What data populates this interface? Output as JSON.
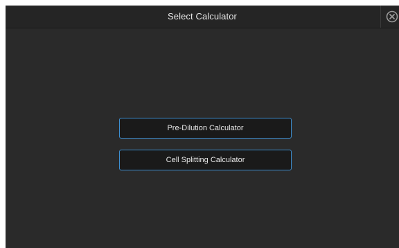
{
  "window": {
    "title": "Select Calculator"
  },
  "buttons": {
    "pre_dilution": "Pre-Dilution Calculator",
    "cell_splitting": "Cell Splitting Calculator"
  },
  "colors": {
    "background": "#2a2a2a",
    "button_border": "#3d8fd1",
    "button_fill": "#1a1a1a",
    "text": "#e6e6e6"
  },
  "icons": {
    "close": "close-icon"
  }
}
